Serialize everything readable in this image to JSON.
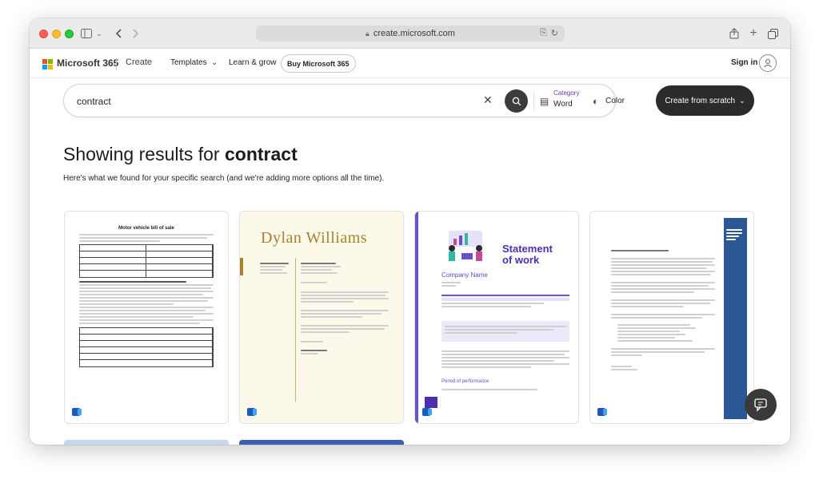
{
  "browser": {
    "url": "create.microsoft.com",
    "icons": [
      "sidebar-icon",
      "chevron-down-icon",
      "back-icon",
      "forward-icon",
      "translate-icon",
      "reload-icon",
      "share-icon",
      "new-tab-icon",
      "tabs-icon"
    ]
  },
  "header": {
    "brand": "Microsoft 365",
    "section": "Create",
    "nav": {
      "templates": "Templates",
      "learn": "Learn & grow"
    },
    "buy_label": "Buy Microsoft 365",
    "signin_label": "Sign in",
    "logo_colors": [
      "#f25022",
      "#7fba00",
      "#00a4ef",
      "#ffb900"
    ]
  },
  "search": {
    "query": "contract",
    "category_label": "Category",
    "category_value": "Word",
    "color_label": "Color",
    "create_from_scratch": "Create from scratch"
  },
  "results": {
    "title_prefix": "Showing results for ",
    "title_term": "contract",
    "subtitle": "Here's what we found for your specific search (and we're adding more options all the time)."
  },
  "cards": [
    {
      "doc_title": "Motor vehicle bill of sale",
      "app_icon": "word-icon"
    },
    {
      "doc_title": "Dylan Williams",
      "app_icon": "word-icon"
    },
    {
      "doc_title": "Statement of work",
      "company": "Company Name",
      "section": "Period of performance",
      "app_icon": "word-icon"
    },
    {
      "app_icon": "word-icon"
    }
  ]
}
